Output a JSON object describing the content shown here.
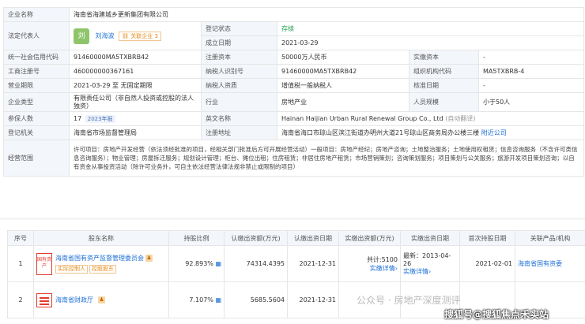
{
  "company": {
    "name_label": "企业名称",
    "name": "海南省海建城乡更新集团有限公司",
    "legal_label": "法定代表人",
    "legal_avatar": "刘",
    "legal_name": "刘海波",
    "related_tag": "关联企业 3",
    "reg_status_label": "登记状态",
    "reg_status": "存续",
    "found_date_label": "成立日期",
    "found_date": "2021-03-29",
    "credit_code_label": "统一社会信用代码",
    "credit_code": "91460000MA5TXBRB42",
    "reg_capital_label": "注册资本",
    "reg_capital": "50000万人民币",
    "paid_capital_label": "实缴资本",
    "paid_capital": "-",
    "biz_no_label": "工商注册号",
    "biz_no": "460000000367161",
    "tax_id_label": "纳税人识别号",
    "tax_id": "91460000MA5TXBRB42",
    "org_code_label": "组织机构代码",
    "org_code": "MA5TXBRB-4",
    "term_label": "营业期限",
    "term": "2021-03-29 至 无固定期限",
    "taxpayer_label": "纳税人资质",
    "taxpayer": "增值税一般纳税人",
    "approve_label": "核准日期",
    "approve": "-",
    "type_label": "企业类型",
    "type": "有限责任公司（非自然人投资或控股的法人独资）",
    "industry_label": "行业",
    "industry": "房地产业",
    "staff_label": "人员规模",
    "staff": "小于50人",
    "insured_label": "参保人数",
    "insured": "17",
    "insured_tag": "2023年报",
    "en_label": "英文名称",
    "en_name": "Hainan Haijian Urban Rural Renewal Group Co., Ltd",
    "en_note": "(自动翻译)",
    "authority_label": "登记机关",
    "authority": "海南省市场监督管理局",
    "address_label": "注册地址",
    "address": "海南省海口市琼山区滨江街道办明州大道21号琼山区商务局办公楼三楼",
    "nearby": "附近公司",
    "scope_label": "经营范围",
    "scope": "许可项目：房地产开发经营（依法须经批准的项目，经相关部门批准后方可开展经营活动）一般项目：房地产经纪；房地产咨询；土地整治服务；土地使用权租赁；信息咨询服务（不含许可类信息咨询服务）；物业管理；房屋拆迁服务；规划设计管理；柜台、摊位出租；住房租赁；非居住房地产租赁；市场营销策划；咨询策划服务；项目策划与公关服务；旅游开发项目策划咨询；以自有资金从事投资活动（除许可业务外，可自主依法经营法律法规非禁止或限制的项目）"
  },
  "shareholders": {
    "headers": [
      "序号",
      "股东名称",
      "持股比例",
      "认缴出资额(万元)",
      "认缴出资日期",
      "实缴出资额(万元)",
      "实缴出资日期",
      "首次持股日期",
      "关联产品/机构"
    ],
    "rows": [
      {
        "idx": "1",
        "logo_text": "国有资产",
        "name": "海南省国有资产监督管理委员会",
        "tags": [
          "实际控制人",
          "控股股东"
        ],
        "pct": "92.893%",
        "sub_amount": "74314.4395",
        "sub_date": "2021-12-31",
        "paid_total": "共计:5100",
        "paid_detail": "实缴详情",
        "paid_date": "最新：2013-04-26",
        "paid_date_detail": "实缴详情",
        "first_date": "2021-02-01",
        "related": "海南省国有资委"
      },
      {
        "idx": "2",
        "name": "海南省财政厅",
        "pct": "7.107%",
        "sub_amount": "5685.5604",
        "sub_date": "2021-12-31"
      }
    ]
  },
  "watermark": "公众号 · 房地产深度测评",
  "watermark2": "搜狐号@搜狐焦点禾实站"
}
